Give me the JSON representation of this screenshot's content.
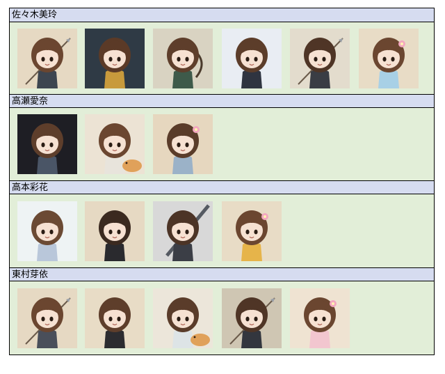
{
  "groups": [
    {
      "name": "佐々木美玲",
      "cards": [
        {
          "icon": "chibi-character-with-spear-icon",
          "bg": "#e6d9c3",
          "hair": "#6b4630",
          "outfit": "#3d4550",
          "extra": "spear"
        },
        {
          "icon": "chibi-character-dark-scene-icon",
          "bg": "#2f3a45",
          "hair": "#5b3a27",
          "outfit": "#c89a3c",
          "extra": "none"
        },
        {
          "icon": "chibi-character-with-crossbow-icon",
          "bg": "#d9d3c2",
          "hair": "#5e3e2b",
          "outfit": "#3e5a4a",
          "extra": "bow"
        },
        {
          "icon": "chibi-character-snow-scene-icon",
          "bg": "#e9edf3",
          "hair": "#5c3d2a",
          "outfit": "#2f3440",
          "extra": "none"
        },
        {
          "icon": "chibi-character-with-lance-icon",
          "bg": "#e3dccd",
          "hair": "#4f3526",
          "outfit": "#3a3d44",
          "extra": "spear"
        },
        {
          "icon": "chibi-character-yukata-icon",
          "bg": "#e8dcc6",
          "hair": "#6b4630",
          "outfit": "#a8d0e6",
          "extra": "flower"
        }
      ]
    },
    {
      "name": "高瀬愛奈",
      "cards": [
        {
          "icon": "chibi-character-night-scene-icon",
          "bg": "#1e1e24",
          "hair": "#5e3e2b",
          "outfit": "#4a5566",
          "extra": "none"
        },
        {
          "icon": "chibi-character-with-hamster-icon",
          "bg": "#ece3d4",
          "hair": "#6b4630",
          "outfit": "#e8e4dc",
          "extra": "pet"
        },
        {
          "icon": "chibi-character-hair-bun-icon",
          "bg": "#e6d7bf",
          "hair": "#5a3c2a",
          "outfit": "#9bb2c8",
          "extra": "flower"
        }
      ]
    },
    {
      "name": "高本彩花",
      "cards": [
        {
          "icon": "chibi-character-plaid-dress-icon",
          "bg": "#eef3f4",
          "hair": "#6b4a34",
          "outfit": "#b9c7da",
          "extra": "none"
        },
        {
          "icon": "chibi-character-dark-outfit-icon",
          "bg": "#e6d9c3",
          "hair": "#3b2a20",
          "outfit": "#2a2a2e",
          "extra": "none"
        },
        {
          "icon": "chibi-character-with-greatsword-icon",
          "bg": "#d8d8d8",
          "hair": "#4c3426",
          "outfit": "#3b3e46",
          "extra": "sword"
        },
        {
          "icon": "chibi-character-floral-yukata-icon",
          "bg": "#e8dcc6",
          "hair": "#6b4630",
          "outfit": "#e6b44a",
          "extra": "flower"
        }
      ]
    },
    {
      "name": "東村芽依",
      "cards": [
        {
          "icon": "chibi-character-armored-spear-icon",
          "bg": "#e6d9c3",
          "hair": "#6b4630",
          "outfit": "#4a4f5a",
          "extra": "spear"
        },
        {
          "icon": "chibi-character-closeup-icon",
          "bg": "#e8dcc6",
          "hair": "#5e3e2b",
          "outfit": "#2c2c30",
          "extra": "none"
        },
        {
          "icon": "chibi-character-with-cat-icon",
          "bg": "#ece6da",
          "hair": "#5a3c2a",
          "outfit": "#dde4e6",
          "extra": "pet"
        },
        {
          "icon": "chibi-character-castle-wall-icon",
          "bg": "#cfc6b3",
          "hair": "#4f3526",
          "outfit": "#33363e",
          "extra": "spear"
        },
        {
          "icon": "chibi-character-braided-yukata-icon",
          "bg": "#efe3d2",
          "hair": "#6b4630",
          "outfit": "#f2c6cf",
          "extra": "flower"
        }
      ]
    }
  ]
}
